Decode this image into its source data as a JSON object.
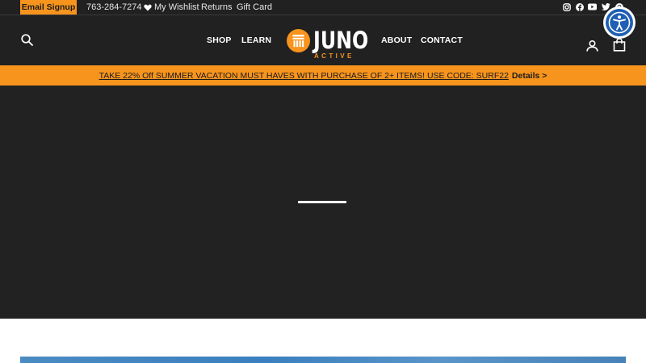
{
  "utility_bar": {
    "signup_label": "Email Signup",
    "phone": "763-284-7274",
    "wishlist_label": "My Wishlist",
    "returns_label": "Returns",
    "giftcard_label": "Gift Card",
    "social_icons": [
      "instagram-icon",
      "facebook-icon",
      "youtube-icon",
      "twitter-icon",
      "pinterest-icon"
    ]
  },
  "header": {
    "nav_left": [
      "SHOP",
      "LEARN"
    ],
    "nav_right": [
      "ABOUT",
      "CONTACT"
    ],
    "logo": {
      "word": "JUNO",
      "subword": "ACTIVE"
    },
    "icons": [
      "search-icon",
      "account-icon",
      "cart-icon"
    ]
  },
  "promo": {
    "message": "TAKE 22% Off SUMMER VACATION MUST HAVES WITH PURCHASE OF 2+ ITEMS! USE CODE: SURF22",
    "details_label": "Details >"
  },
  "colors": {
    "brand_orange": "#f7941d",
    "dark_bg": "#212121",
    "accessibility_blue": "#1f5fb4"
  }
}
